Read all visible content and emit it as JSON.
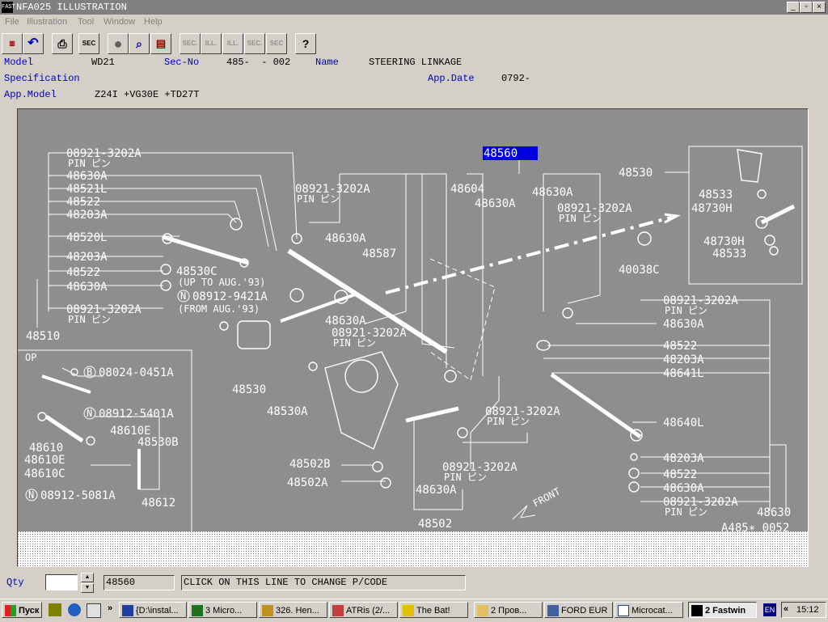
{
  "window": {
    "title": "NFA025 ILLUSTRATION",
    "app_icon": "FAST"
  },
  "menu": [
    "File",
    "Illustration",
    "Tool",
    "Window",
    "Help"
  ],
  "toolbar": {
    "sec_label": "SEC",
    "ill_label": "ILL.",
    "sec_dot_label": "SEC."
  },
  "header": {
    "model_label": "Model",
    "model": "WD21",
    "sec_no_label": "Sec-No",
    "sec_no": "485-  - 002",
    "name_label": "Name",
    "name": "STEERING LINKAGE",
    "spec_label": "Specification",
    "app_date_label": "App.Date",
    "app_date": "0792-",
    "app_model_label": "App.Model",
    "app_model": "Z24I +VG30E +TD27T"
  },
  "diagram": {
    "highlight": "48560",
    "ref": "A485∗ 0052",
    "front": "FRONT",
    "op_label": "OP",
    "upto": "(UP TO AUG.'93)",
    "from": "(FROM AUG.'93)",
    "pin": "PIN ピン",
    "n08912_9421A": "08912-9421A",
    "b08024": "08024-0451A",
    "n08912_5401A": "08912-5401A",
    "n08912_5081A": "08912-5081A",
    "left_labels": [
      "08921-3202A",
      "48630A",
      "48521L",
      "48522",
      "48203A",
      "48520L",
      "48203A",
      "48522",
      "48630A",
      "08921-3202A"
    ],
    "right_labels": [
      "08921-3202A",
      "48630A",
      "48522",
      "48203A",
      "48641L",
      "48640L",
      "48203A",
      "48522",
      "48630A",
      "08921-3202A"
    ],
    "center_labels": [
      "08921-3202A",
      "48630A",
      "48587",
      "48604",
      "48630A",
      "48630A",
      "08921-3202A",
      "48530",
      "40038C",
      "48533",
      "48730H",
      "48730H",
      "48533",
      "48530C",
      "48510",
      "48630A",
      "08921-3202A",
      "48530",
      "48530A",
      "08921-3202A",
      "08921-3202A",
      "48502B",
      "48502A",
      "48630A",
      "48502",
      "48630"
    ],
    "op_labels": [
      "48610",
      "48610E",
      "48610C",
      "48610E",
      "48530B",
      "48612"
    ]
  },
  "bottom": {
    "qty_label": "Qty",
    "qty_value": "",
    "pcode": "48560",
    "message": "CLICK ON THIS LINE TO CHANGE P/CODE"
  },
  "taskbar": {
    "start": "Пуск",
    "tasks": [
      "{D:\\instal...",
      "3 Micro...",
      "326. Hen...",
      "ATRis (2/...",
      "The Bat!",
      "2 Пров...",
      "FORD EUR",
      "Microcat...",
      "2 Fastwin"
    ],
    "lang": "EN",
    "clock": "15:12"
  }
}
